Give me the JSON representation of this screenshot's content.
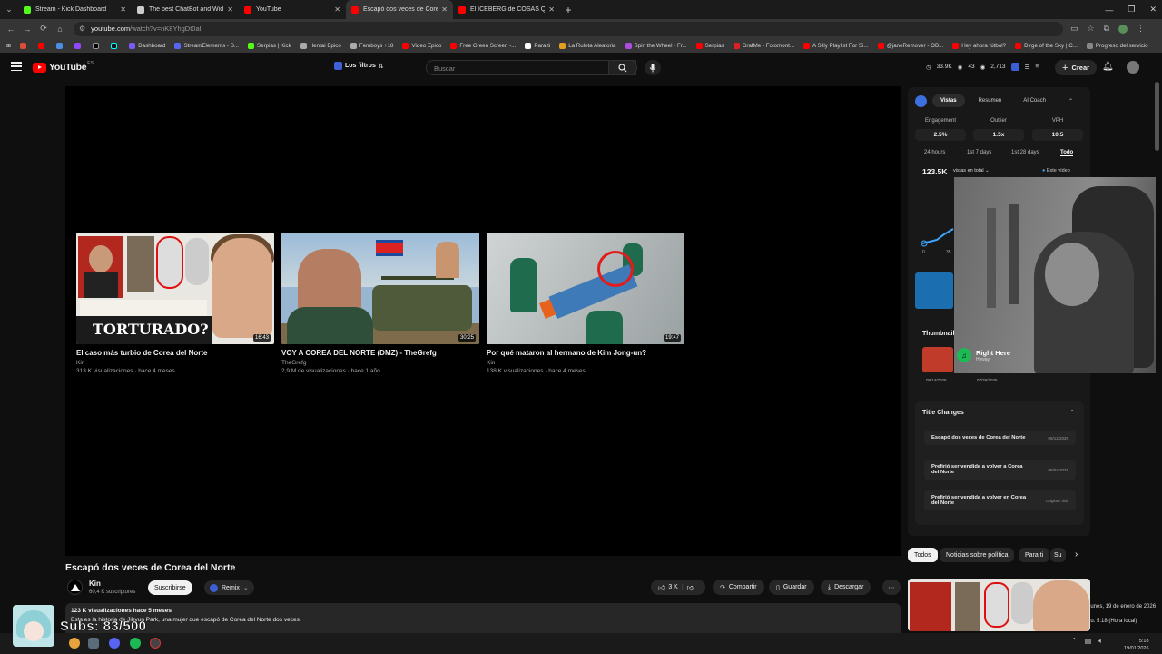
{
  "browser": {
    "tabs": [
      {
        "label": "Stream - Kick Dashboard",
        "color": "#53fc18",
        "active": false
      },
      {
        "label": "The best ChatBot and Widgets",
        "color": "#cccccc",
        "active": false
      },
      {
        "label": "YouTube",
        "color": "#ff0000",
        "active": false
      },
      {
        "label": "Escapó dos veces de Corea del",
        "color": "#ff0000",
        "active": true
      },
      {
        "label": "El ICEBERG de COSAS QUE NO",
        "color": "#ff0000",
        "active": false
      }
    ],
    "url_host": "youtube.com",
    "url_path": "/watch?v=nK8YhgDt0aI",
    "bookmarks": [
      {
        "label": "Dashboard",
        "color": "#7a5af8"
      },
      {
        "label": "StreamElements - S...",
        "color": "#5865f2"
      },
      {
        "label": "Serpias | Kick",
        "color": "#53fc18"
      },
      {
        "label": "Hentai Epico",
        "color": "#aaaaaa"
      },
      {
        "label": "Femboys +18",
        "color": "#aaaaaa"
      },
      {
        "label": "Video Epico",
        "color": "#ff0000"
      },
      {
        "label": "Free Green Screen -...",
        "color": "#ff0000"
      },
      {
        "label": "Para ti",
        "color": "#ffffff"
      },
      {
        "label": "La Ruleta Aleatoria",
        "color": "#e0a020"
      },
      {
        "label": "Spin the Wheel - Fr...",
        "color": "#b04de0"
      },
      {
        "label": "Serpias",
        "color": "#ff0000"
      },
      {
        "label": "GrafMe - Fotomont...",
        "color": "#e02020"
      },
      {
        "label": "A Silly Playlist For Si...",
        "color": "#ff0000"
      },
      {
        "label": "@janeRemover - OB...",
        "color": "#ff0000"
      },
      {
        "label": "Hey ahora fútbol?",
        "color": "#ff0000"
      },
      {
        "label": "Dirge of the Sky | C...",
        "color": "#ff0000"
      },
      {
        "label": "Progreso del servicio",
        "color": "#888888"
      }
    ]
  },
  "header": {
    "logo_text": "YouTube",
    "logo_suffix": "ES",
    "filters_label": "Los filtros",
    "search_placeholder": "Buscar",
    "stats": [
      "33.9K",
      "43",
      "2,713"
    ],
    "create_label": "Crear"
  },
  "endscreen": [
    {
      "title": "El caso más turbio de Corea del Norte",
      "channel": "Kin",
      "meta": "313 K visualizaciones · hace 4 meses",
      "duration": "16:43",
      "banner": "TORTURADO?"
    },
    {
      "title": "VOY A COREA DEL NORTE (DMZ) - TheGrefg",
      "channel": "TheGrefg",
      "meta": "2,9 M de visualizaciones · hace 1 año",
      "duration": "30:25"
    },
    {
      "title": "Por qué mataron al hermano de Kim Jong-un?",
      "channel": "Kin",
      "meta": "138 K visualizaciones · hace 4 meses",
      "duration": "19:47"
    }
  ],
  "video": {
    "title": "Escapó dos veces de Corea del Norte",
    "channel": "Kin",
    "subscribers": "60,4 K suscriptores",
    "subscribe_label": "Suscribirse",
    "remix_label": "Remix",
    "likes": "3 K",
    "share_label": "Compartir",
    "save_label": "Guardar",
    "download_label": "Descargar",
    "desc_meta": "123 K visualizaciones  hace 5 meses",
    "desc_text": "Esta es la historia de Jihyun Park, una mujer que escapó de Corea del Norte dos veces."
  },
  "panel": {
    "tabs": [
      "Vistas",
      "Resumen",
      "AI Coach"
    ],
    "metrics": [
      {
        "label": "Engagement",
        "value": "2.5%"
      },
      {
        "label": "Outlier",
        "value": "1.5x"
      },
      {
        "label": "VPH",
        "value": "10.5"
      }
    ],
    "ranges": [
      "24 hours",
      "1st 7 days",
      "1st 28 days",
      "Todo"
    ],
    "views_total": "123.5K",
    "views_sub": "vistas en total",
    "este_video": "Este vídeo",
    "thumbnails_title": "Thumbnail",
    "thumb_dates": [
      "09/14/2025",
      "07/26/2025"
    ],
    "title_changes_title": "Title Changes",
    "title_changes": [
      {
        "title": "Escapó dos veces de Corea del Norte",
        "date": "09/12/2025"
      },
      {
        "title": "Prefirió ser vendida a volver a Corea del Norte",
        "date": "08/04/2025"
      },
      {
        "title": "Prefirió ser vendida a volver en Corea del Norte",
        "date": "Original Title"
      }
    ]
  },
  "spotify": {
    "song": "Right Here",
    "artist": "Hyway"
  },
  "chips": [
    "Todos",
    "Noticias sobre política",
    "Para ti",
    "Su"
  ],
  "overlay": {
    "subs": "Subs: 83/500",
    "date_line1": "lunes, 19 de enero de 2026",
    "date_line2": "lu. 5:18 (Hora local)"
  },
  "taskbar": {
    "time": "5:18",
    "date": "19/01/2026"
  }
}
